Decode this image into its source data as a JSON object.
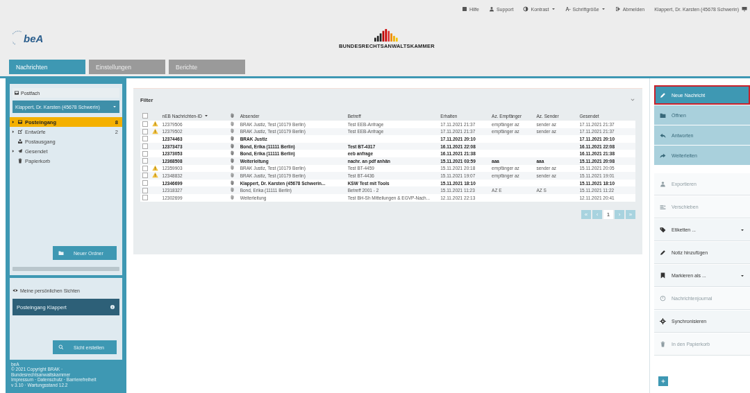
{
  "top_links": [
    {
      "label": "Hilfe",
      "dropdown": false
    },
    {
      "label": "Support",
      "dropdown": false
    },
    {
      "label": "Kontrast",
      "dropdown": true
    },
    {
      "label": "Schriftgröße",
      "dropdown": true
    },
    {
      "label": "Abmelden",
      "dropdown": false
    }
  ],
  "user": "Klappert, Dr. Karsten (45678 Schwerin)",
  "logo": {
    "text": "beA"
  },
  "org": "BUNDESRECHTSANWALTSKAMMER",
  "tabs": [
    {
      "label": "Nachrichten",
      "selected": true
    },
    {
      "label": "Einstellungen",
      "selected": false
    },
    {
      "label": "Berichte",
      "selected": false
    }
  ],
  "sidebar": {
    "title": "Postfach",
    "mailbox": "Klappert, Dr. Karsten (45678 Schwerin)",
    "folders": [
      {
        "label": "Posteingang",
        "count": "8",
        "selected": true,
        "expandable": true
      },
      {
        "label": "Entwürfe",
        "count": "2",
        "selected": false,
        "expandable": true
      },
      {
        "label": "Postausgang",
        "selected": false,
        "expandable": false
      },
      {
        "label": "Gesendet",
        "selected": false,
        "expandable": true
      },
      {
        "label": "Papierkorb",
        "selected": false,
        "expandable": false
      }
    ],
    "new_folder": "Neuer Ordner",
    "views_title": "Meine persönlichen Sichten",
    "view": "Posteingang Klappert",
    "create_view": "Sicht erstellen",
    "footer": [
      "beA",
      "© 2021 Copyright BRAK · Bundesrechtsanwaltskammer",
      "Impressum · Datenschutz · Barrierefreiheit",
      "v 3.10 · Wartungsstand 12.2"
    ]
  },
  "filter": {
    "title": "Filter"
  },
  "table": {
    "select_all_checked": false,
    "columns": [
      "nEB Nachrichten-ID",
      "Absender",
      "Betreff",
      "Erhalten",
      "Az. Empfänger",
      "Az. Sender",
      "Gesendet"
    ],
    "rows": [
      {
        "checked": false,
        "warning": true,
        "unread": false,
        "cells": [
          "12379506",
          "BRAK Justiz, Test (10179 Berlin)",
          "Test EEB-Anfrage",
          "17.11.2021 21:37",
          "empfänger az",
          "sender az",
          "17.11.2021 21:37"
        ]
      },
      {
        "checked": false,
        "warning": true,
        "unread": false,
        "cells": [
          "12379502",
          "BRAK Justiz, Test (10179 Berlin)",
          "Test EEB-Anfrage",
          "17.11.2021 21:37",
          "empfänger az",
          "sender az",
          "17.11.2021 21:37"
        ]
      },
      {
        "checked": false,
        "warning": false,
        "unread": true,
        "cells": [
          "12374463",
          "BRAK Justiz",
          "",
          "17.11.2021 20:10",
          "",
          "",
          "17.11.2021 20:10"
        ]
      },
      {
        "checked": false,
        "warning": false,
        "unread": true,
        "cells": [
          "12373473",
          "Bond, Erika (11111 Berlin)",
          "Test BT-4317",
          "16.11.2021 22:08",
          "",
          "",
          "16.11.2021 22:08"
        ]
      },
      {
        "checked": false,
        "warning": false,
        "unread": true,
        "cells": [
          "12373053",
          "Bond, Erika (11111 Berlin)",
          "eeb anfrage",
          "16.11.2021 21:38",
          "",
          "",
          "16.11.2021 21:38"
        ]
      },
      {
        "checked": false,
        "warning": false,
        "unread": true,
        "cells": [
          "12368508",
          "Weiterleitung",
          "nachr. an pdf anhän",
          "15.11.2021 03:59",
          "aaa",
          "aaa",
          "15.11.2021 20:08"
        ]
      },
      {
        "checked": false,
        "warning": true,
        "unread": false,
        "cells": [
          "12359903",
          "BRAK Justiz, Test (10179 Berlin)",
          "Test BT-4459",
          "15.11.2021 20:18",
          "empfänger az",
          "sender az",
          "15.11.2021 20:05"
        ]
      },
      {
        "checked": false,
        "warning": true,
        "unread": false,
        "cells": [
          "12348832",
          "BRAK Justiz, Test (10179 Berlin)",
          "Test BT-4436",
          "15.11.2021 19:07",
          "empfänger az",
          "sender az",
          "15.11.2021 19:01"
        ]
      },
      {
        "checked": false,
        "warning": false,
        "unread": true,
        "cells": [
          "12346699",
          "Klappert, Dr. Karsten (45678 Schwerin...",
          "KSW Test mit Tools",
          "15.11.2021 18:10",
          "",
          "",
          "15.11.2021 18:10"
        ]
      },
      {
        "checked": false,
        "warning": false,
        "unread": false,
        "cells": [
          "12318327",
          "Bond, Erika (11111 Berlin)",
          "Betreff 2001 - 2",
          "15.11.2021 11:23",
          "AZ E",
          "AZ S",
          "15.11.2021 11:22"
        ]
      },
      {
        "checked": false,
        "warning": false,
        "unread": false,
        "cells": [
          "12302699",
          "Weiterleitung",
          "Test BH-Sh Mitteilungen & EGVP-Nach...",
          "12.11.2021 22:13",
          "",
          "",
          "12.11.2021 20:41"
        ]
      }
    ]
  },
  "pagination": [
    {
      "label": "«",
      "selected": false
    },
    {
      "label": "‹",
      "selected": false
    },
    {
      "label": "1",
      "selected": true
    },
    {
      "label": "›",
      "selected": false
    },
    {
      "label": "»",
      "selected": false
    }
  ],
  "actions": [
    {
      "kind": "primary",
      "label": "Neue Nachricht",
      "disabled": false,
      "highlighted": true
    },
    {
      "kind": "primary",
      "label": "Öffnen",
      "disabled": true,
      "highlighted": false
    },
    {
      "kind": "primary",
      "label": "Antworten",
      "disabled": true,
      "highlighted": false
    },
    {
      "kind": "primary",
      "label": "Weiterleiten",
      "disabled": true,
      "highlighted": false
    },
    {
      "kind": "plain",
      "label": "Exportieren",
      "disabled": true,
      "highlighted": false
    },
    {
      "kind": "plain",
      "label": "Verschieben",
      "disabled": true,
      "highlighted": false
    },
    {
      "kind": "menu",
      "label": "Etiketten ...",
      "disabled": false,
      "highlighted": false
    },
    {
      "kind": "plain",
      "label": "Notiz hinzufügen",
      "disabled": false,
      "highlighted": false
    },
    {
      "kind": "menu",
      "label": "Markieren als ...",
      "disabled": false,
      "highlighted": false
    },
    {
      "kind": "plain",
      "label": "Nachrichtenjournal",
      "disabled": true,
      "highlighted": false
    },
    {
      "kind": "plain",
      "label": "Synchronisieren",
      "disabled": false,
      "highlighted": false
    },
    {
      "kind": "plain",
      "label": "In den Papierkorb",
      "disabled": true,
      "highlighted": false
    }
  ]
}
